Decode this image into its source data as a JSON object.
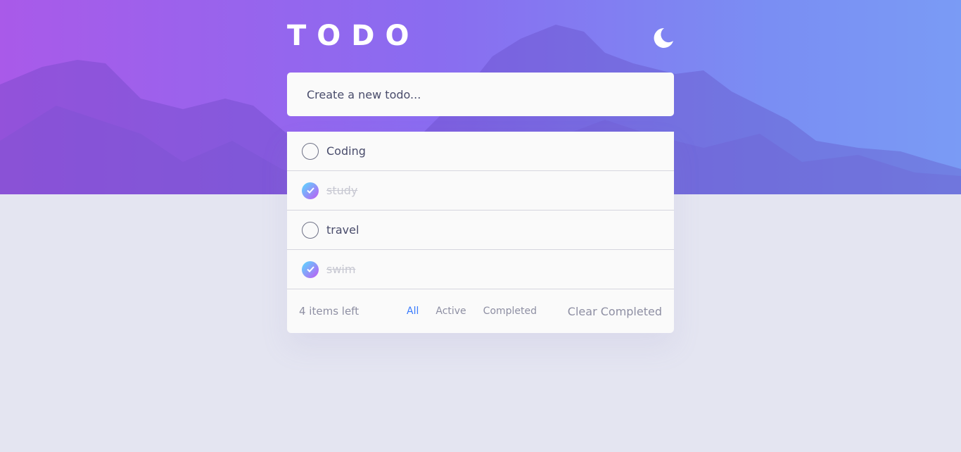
{
  "app": {
    "title": "TODO"
  },
  "new_todo": {
    "placeholder": "Create a new todo..."
  },
  "todos": [
    {
      "text": "Coding",
      "completed": false
    },
    {
      "text": "study",
      "completed": true
    },
    {
      "text": "travel",
      "completed": false
    },
    {
      "text": "swim",
      "completed": true
    }
  ],
  "footer": {
    "items_left": "4 items left",
    "filters": [
      "All",
      "Active",
      "Completed"
    ],
    "active_filter": "All",
    "clear_label": "Clear Completed"
  },
  "icons": {
    "theme_toggle": "moon-icon",
    "check": "check-icon"
  },
  "colors": {
    "accent": "#3a7bfd",
    "check_gradient_start": "#57ddff",
    "check_gradient_end": "#c058f3",
    "page_background": "#e4e5f1",
    "card_background": "#fafafa"
  }
}
